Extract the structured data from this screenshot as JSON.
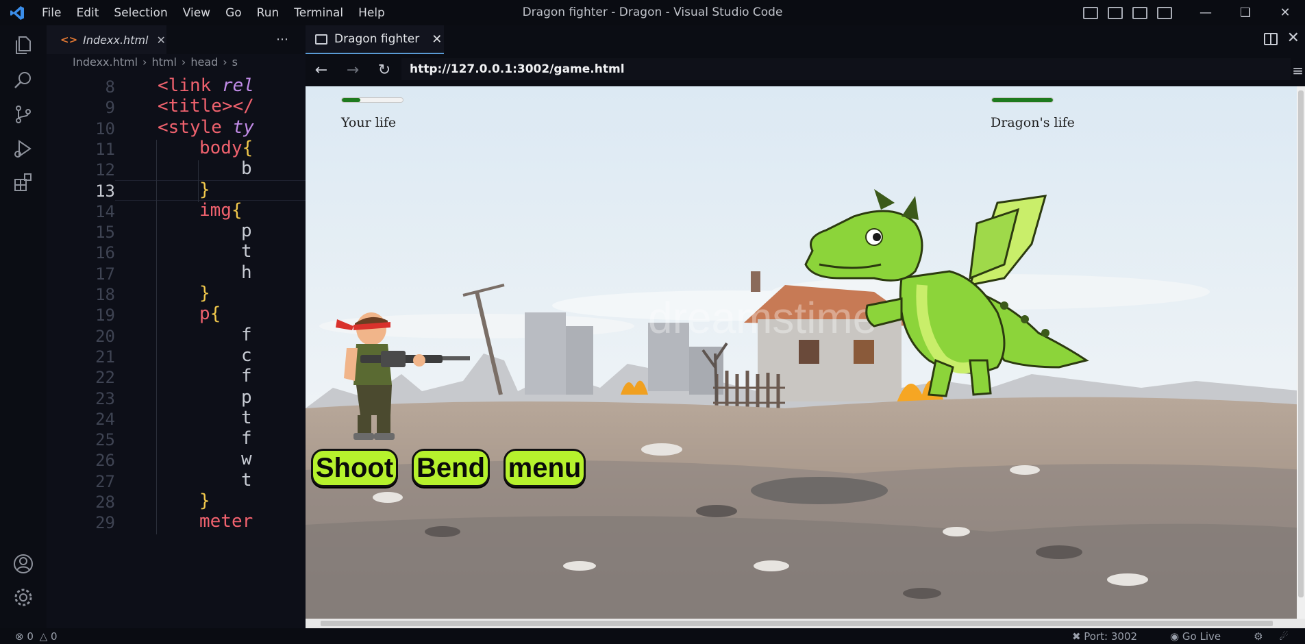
{
  "window": {
    "title": "Dragon fighter - Dragon - Visual Studio Code",
    "menu": [
      "File",
      "Edit",
      "Selection",
      "View",
      "Go",
      "Run",
      "Terminal",
      "Help"
    ]
  },
  "editor": {
    "tab_label": "Indexx.html",
    "breadcrumbs": [
      "Indexx.html",
      "html",
      "head",
      "s"
    ],
    "current_line": 13,
    "lines": [
      {
        "n": "8",
        "text": "<link rel"
      },
      {
        "n": "9",
        "text": "<title></"
      },
      {
        "n": "10",
        "text": "<style ty"
      },
      {
        "n": "11",
        "text": "body{"
      },
      {
        "n": "12",
        "text": "b"
      },
      {
        "n": "13",
        "text": "}"
      },
      {
        "n": "14",
        "text": "img{"
      },
      {
        "n": "15",
        "text": "p"
      },
      {
        "n": "16",
        "text": "t"
      },
      {
        "n": "17",
        "text": "h"
      },
      {
        "n": "18",
        "text": "}"
      },
      {
        "n": "19",
        "text": "p{"
      },
      {
        "n": "20",
        "text": "f"
      },
      {
        "n": "21",
        "text": "c"
      },
      {
        "n": "22",
        "text": "f"
      },
      {
        "n": "23",
        "text": "p"
      },
      {
        "n": "24",
        "text": "t"
      },
      {
        "n": "25",
        "text": "f"
      },
      {
        "n": "26",
        "text": "w"
      },
      {
        "n": "27",
        "text": "t"
      },
      {
        "n": "28",
        "text": "}"
      },
      {
        "n": "29",
        "text": "meter"
      }
    ]
  },
  "browser": {
    "tab_label": "Dragon fighter",
    "url": "http://127.0.0.1:3002/game.html"
  },
  "game": {
    "your_life_label": "Your life",
    "dragon_life_label": "Dragon's life",
    "your_life_fraction": 0.3,
    "dragon_life_fraction": 1.0,
    "buttons": {
      "shoot": "Shoot",
      "bend": "Bend",
      "menu": "menu"
    },
    "watermark": "dreamstime"
  },
  "status": {
    "errors": "0",
    "warnings": "0",
    "port": "Port: 3002",
    "golive": "Go Live"
  },
  "colors": {
    "button_fill": "#b6f22d",
    "meter_fill": "#1e7a1e",
    "dragon_green": "#8cd43a",
    "accent_blue": "#3b8eea"
  }
}
